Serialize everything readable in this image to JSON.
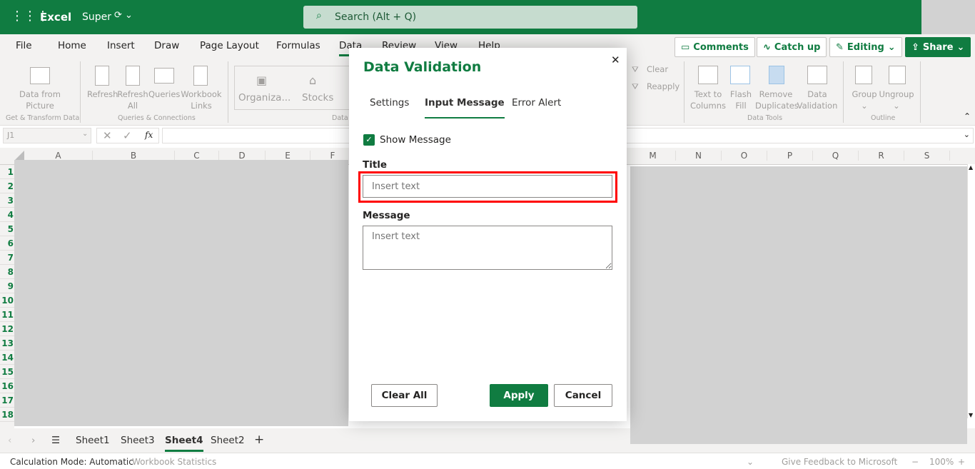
{
  "topbar": {
    "app": "Excel",
    "file": "Super",
    "search_placeholder": "Search (Alt + Q)"
  },
  "menu": [
    "File",
    "Home",
    "Insert",
    "Draw",
    "Page Layout",
    "Formulas",
    "Data",
    "Review",
    "View",
    "Help"
  ],
  "active_menu": "Data",
  "actions": {
    "comments": "Comments",
    "catchup": "Catch up",
    "editing": "Editing",
    "share": "Share"
  },
  "ribbon": {
    "data_from_picture": [
      "Data from",
      "Picture"
    ],
    "refresh": "Refresh",
    "refresh_all": [
      "Refresh",
      "All"
    ],
    "queries": "Queries",
    "workbook_links": [
      "Workbook",
      "Links"
    ],
    "organization": "Organiza...",
    "stocks": "Stocks",
    "clear": "Clear",
    "reapply": "Reapply",
    "text_to_columns": [
      "Text to",
      "Columns"
    ],
    "flash_fill": [
      "Flash",
      "Fill"
    ],
    "remove_duplicates": [
      "Remove",
      "Duplicates"
    ],
    "data_validation": [
      "Data",
      "Validation"
    ],
    "group": "Group",
    "ungroup": "Ungroup",
    "groups": {
      "get_transform": "Get & Transform Data",
      "queries_connections": "Queries & Connections",
      "data_types": "Data",
      "data_tools": "Data Tools",
      "outline": "Outline"
    }
  },
  "formula_bar": {
    "name_box": "J1",
    "fx": "fx",
    "value": ""
  },
  "columns_left": [
    "A",
    "B",
    "C",
    "D",
    "E",
    "F"
  ],
  "columns_right": [
    "M",
    "N",
    "O",
    "P",
    "Q",
    "R",
    "S"
  ],
  "rows": [
    "1",
    "2",
    "3",
    "4",
    "5",
    "6",
    "7",
    "8",
    "9",
    "10",
    "11",
    "12",
    "13",
    "14",
    "15",
    "16",
    "17",
    "18"
  ],
  "dialog": {
    "title": "Data Validation",
    "tabs": [
      "Settings",
      "Input Message",
      "Error Alert"
    ],
    "active_tab": "Input Message",
    "show_message_label": "Show Message",
    "show_message_checked": true,
    "title_label": "Title",
    "title_placeholder": "Insert text",
    "title_value": "",
    "message_label": "Message",
    "message_placeholder": "Insert text",
    "message_value": "",
    "clear_all": "Clear All",
    "apply": "Apply",
    "cancel": "Cancel"
  },
  "sheets": [
    "Sheet1",
    "Sheet3",
    "Sheet4",
    "Sheet2"
  ],
  "active_sheet": "Sheet4",
  "status": {
    "calc_mode": "Calculation Mode: Automatic",
    "workbook_stats": "Workbook Statistics",
    "feedback": "Give Feedback to Microsoft",
    "zoom": "100%"
  },
  "colors": {
    "brand": "#107c41",
    "highlight": "#ff0000"
  }
}
